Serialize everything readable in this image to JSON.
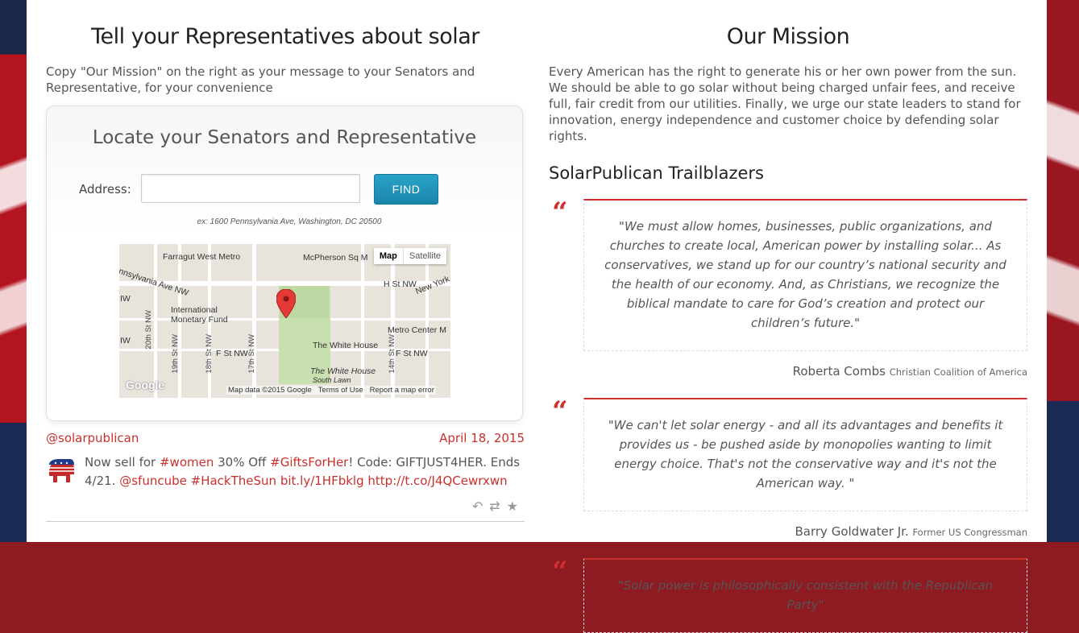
{
  "left": {
    "title": "Tell your Representatives about solar",
    "intro": "Copy \"Our Mission\" on the right as your message to your Senators and Representative, for your convenience",
    "locator": {
      "title": "Locate your Senators and Representative",
      "address_label": "Address:",
      "address_value": "",
      "find_label": "FIND",
      "hint": "ex: 1600 Pennsylvania Ave, Washington, DC 20500",
      "map": {
        "toggle_map": "Map",
        "toggle_satellite": "Satellite",
        "labels": {
          "farragut": "Farragut West Metro",
          "mcpherson": "McPherson Sq M",
          "penn": "ennsylvania Ave NW",
          "hst": "H St NW",
          "newyork": "New York",
          "iw1": "IW",
          "iw2": "IW",
          "imf": "International Monetary Fund",
          "metrocenter": "Metro Center M",
          "whitehouse": "The White House",
          "fst1": "F St NW",
          "fst2": "F St NW",
          "whitehouse2": "The White House",
          "southlawn": "South Lawn",
          "st20": "20th St NW",
          "st19": "19th St NW",
          "st18": "18th St NW",
          "st17": "17th St NW",
          "st14": "14th St NW",
          "google": "Google"
        },
        "footer": {
          "data": "Map data ©2015 Google",
          "terms": "Terms of Use",
          "report": "Report a map error"
        }
      }
    },
    "tweet": {
      "handle": "@solarpublican",
      "date": "April 18, 2015",
      "t1": "Now sell for ",
      "l1": "#women",
      "t2": " 30% Off ",
      "l2": "#GiftsForHer",
      "t3": "! Code: GIFTJUST4HER. Ends 4/21. ",
      "l3": "@sfuncube",
      "t4": " ",
      "l4": "#HackTheSun",
      "t5": " ",
      "l5": "bit.ly/1HFbklg",
      "t6": " ",
      "l6": "http://t.co/J4QCewrxwn"
    }
  },
  "right": {
    "title": "Our Mission",
    "mission": "Every American has the right to generate his or her own power from the sun. We should be able to go solar without being charged unfair fees, and receive full, fair credit from our utilities. Finally, we urge our state leaders to stand for innovation, energy independence and customer choice by defending solar rights.",
    "trailblazers_title": "SolarPublican Trailblazers",
    "quotes": [
      {
        "text": "\"We must allow homes, businesses, public organizations, and churches to create local, American power by installing solar... As conservatives, we stand up for our country’s national security and the health of our economy. And, as Christians, we recognize the biblical mandate to care for God’s creation and protect our children’s future.\"",
        "name": "Roberta Combs",
        "org": "Christian Coalition of America"
      },
      {
        "text": "\"We can't let solar energy - and all its advantages and benefits it provides us - be pushed aside by monopolies wanting to limit energy choice. That's not the conservative way and it's not the American way. \"",
        "name": "Barry Goldwater Jr.",
        "org": "Former US Congressman"
      },
      {
        "text": "\"Solar power is philosophically consistent with the Republican Party\"",
        "name": "",
        "org": ""
      }
    ]
  },
  "colors": {
    "accent_red": "#c9302c",
    "find_button": "#1f94bb"
  }
}
